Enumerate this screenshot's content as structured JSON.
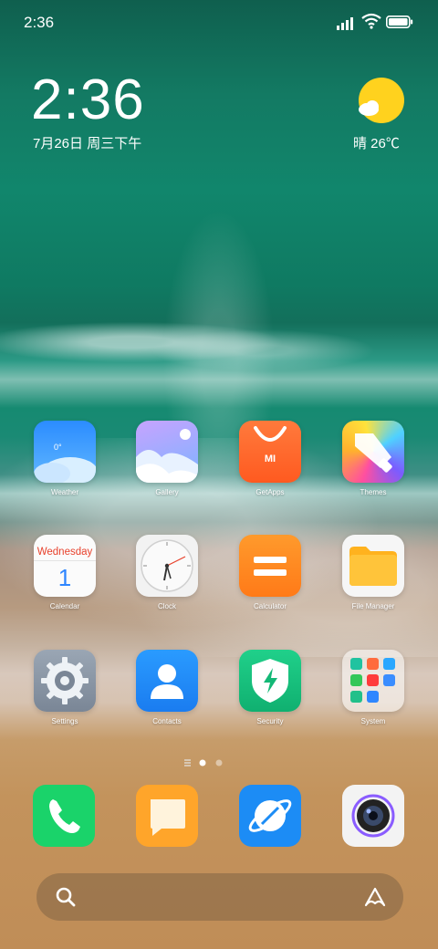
{
  "status": {
    "time": "2:36"
  },
  "lockclock": {
    "time": "2:36",
    "date": "7月26日 周三下午"
  },
  "weather": {
    "text": "晴 26℃"
  },
  "apps": [
    {
      "label": "Weather",
      "icon": "weather-icon",
      "temp": "0°"
    },
    {
      "label": "Gallery",
      "icon": "gallery-icon"
    },
    {
      "label": "GetApps",
      "icon": "getapps-icon",
      "mark": "MI"
    },
    {
      "label": "Themes",
      "icon": "themes-icon"
    },
    {
      "label": "Calendar",
      "icon": "calendar-icon",
      "weekday": "Wednesday",
      "day": "1"
    },
    {
      "label": "Clock",
      "icon": "clock-icon"
    },
    {
      "label": "Calculator",
      "icon": "calculator-icon"
    },
    {
      "label": "File Manager",
      "icon": "file-manager-icon"
    },
    {
      "label": "Settings",
      "icon": "settings-icon"
    },
    {
      "label": "Contacts",
      "icon": "contacts-icon"
    },
    {
      "label": "Security",
      "icon": "security-icon"
    },
    {
      "label": "System",
      "icon": "system-folder-icon"
    }
  ],
  "dock": [
    {
      "name": "phone",
      "icon": "phone-icon"
    },
    {
      "name": "messages",
      "icon": "messages-icon"
    },
    {
      "name": "browser",
      "icon": "browser-icon"
    },
    {
      "name": "camera",
      "icon": "camera-icon"
    }
  ],
  "pager": {
    "pages": 2,
    "current": 1
  },
  "colors": {
    "accent": "#2f86ff",
    "sun": "#ffd21e"
  }
}
